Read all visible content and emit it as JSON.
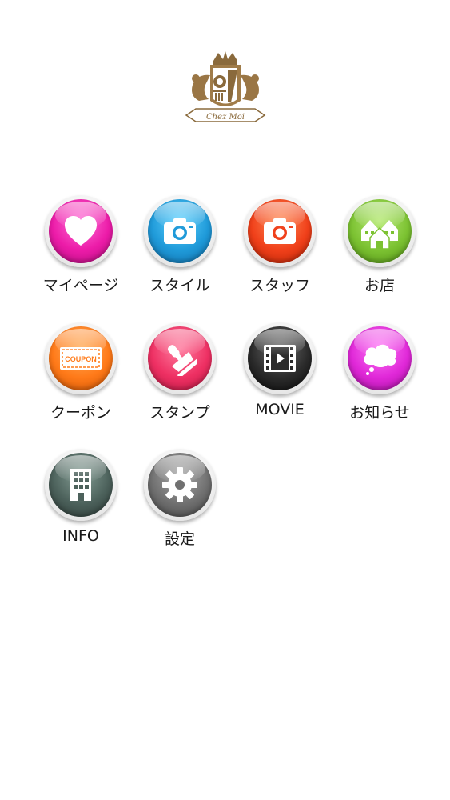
{
  "logo": {
    "text": "Chez Moi",
    "icon": "crest-logo"
  },
  "menu": [
    {
      "label": "マイページ",
      "icon": "heart-icon",
      "color": "#ec1ba8"
    },
    {
      "label": "スタイル",
      "icon": "camera-icon",
      "color": "#1f9ad9"
    },
    {
      "label": "スタッフ",
      "icon": "camera-icon",
      "color": "#f0401a"
    },
    {
      "label": "お店",
      "icon": "houses-icon",
      "color": "#7cc232"
    },
    {
      "label": "クーポン",
      "icon": "coupon-icon",
      "color": "#ff7a19",
      "badge_text": "COUPON"
    },
    {
      "label": "スタンプ",
      "icon": "stamp-icon",
      "color": "#ee3063"
    },
    {
      "label": "MOVIE",
      "icon": "film-icon",
      "color": "#2b2b2b"
    },
    {
      "label": "お知らせ",
      "icon": "speech-cloud-icon",
      "color": "#e028d8"
    },
    {
      "label": "INFO",
      "icon": "building-icon",
      "color": "#4c615b"
    },
    {
      "label": "設定",
      "icon": "gear-icon",
      "color": "#707070"
    }
  ]
}
